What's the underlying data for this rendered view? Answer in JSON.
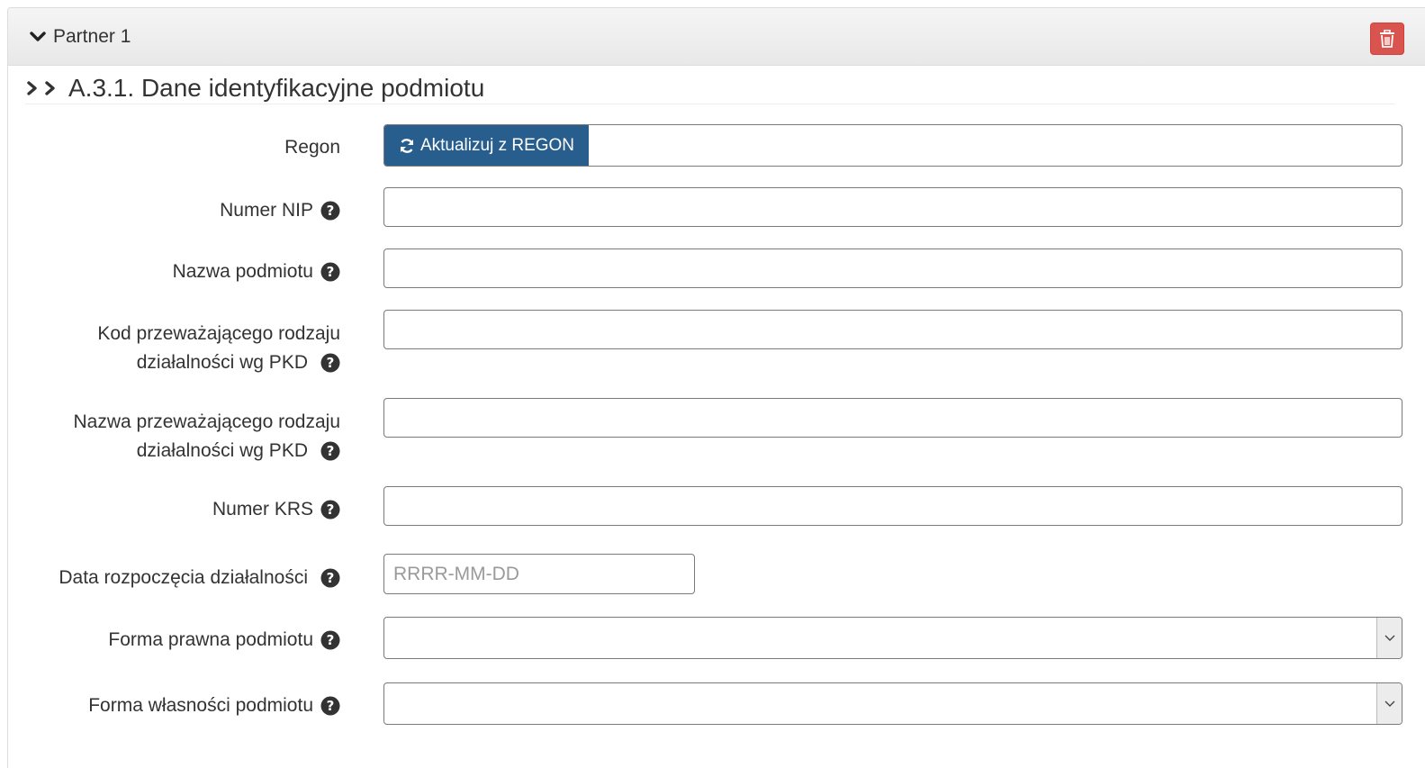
{
  "partner": {
    "title": "Partner 1",
    "delete_label": "trash-icon"
  },
  "section": {
    "title": "A.3.1. Dane identyfikacyjne podmiotu"
  },
  "form": {
    "regon": {
      "label": "Regon",
      "button_label": "Aktualizuj z REGON",
      "value": ""
    },
    "nip": {
      "label": "Numer NIP",
      "value": ""
    },
    "nazwa": {
      "label": "Nazwa podmiotu",
      "value": ""
    },
    "kod_pkd": {
      "label_line1": "Kod przeważającego rodzaju",
      "label_line2": "działalności wg PKD",
      "value": ""
    },
    "nazwa_pkd": {
      "label_line1": "Nazwa przeważającego rodzaju",
      "label_line2": "działalności wg PKD",
      "value": ""
    },
    "krs": {
      "label": "Numer KRS",
      "value": ""
    },
    "data": {
      "label": "Data rozpoczęcia działalności",
      "placeholder": "RRRR-MM-DD",
      "value": ""
    },
    "forma_prawna": {
      "label": "Forma prawna podmiotu",
      "value": ""
    },
    "forma_wlasnosci": {
      "label": "Forma własności podmiotu",
      "value": ""
    }
  },
  "colors": {
    "primary_button": "#285e8e",
    "danger_button": "#d9534f"
  }
}
